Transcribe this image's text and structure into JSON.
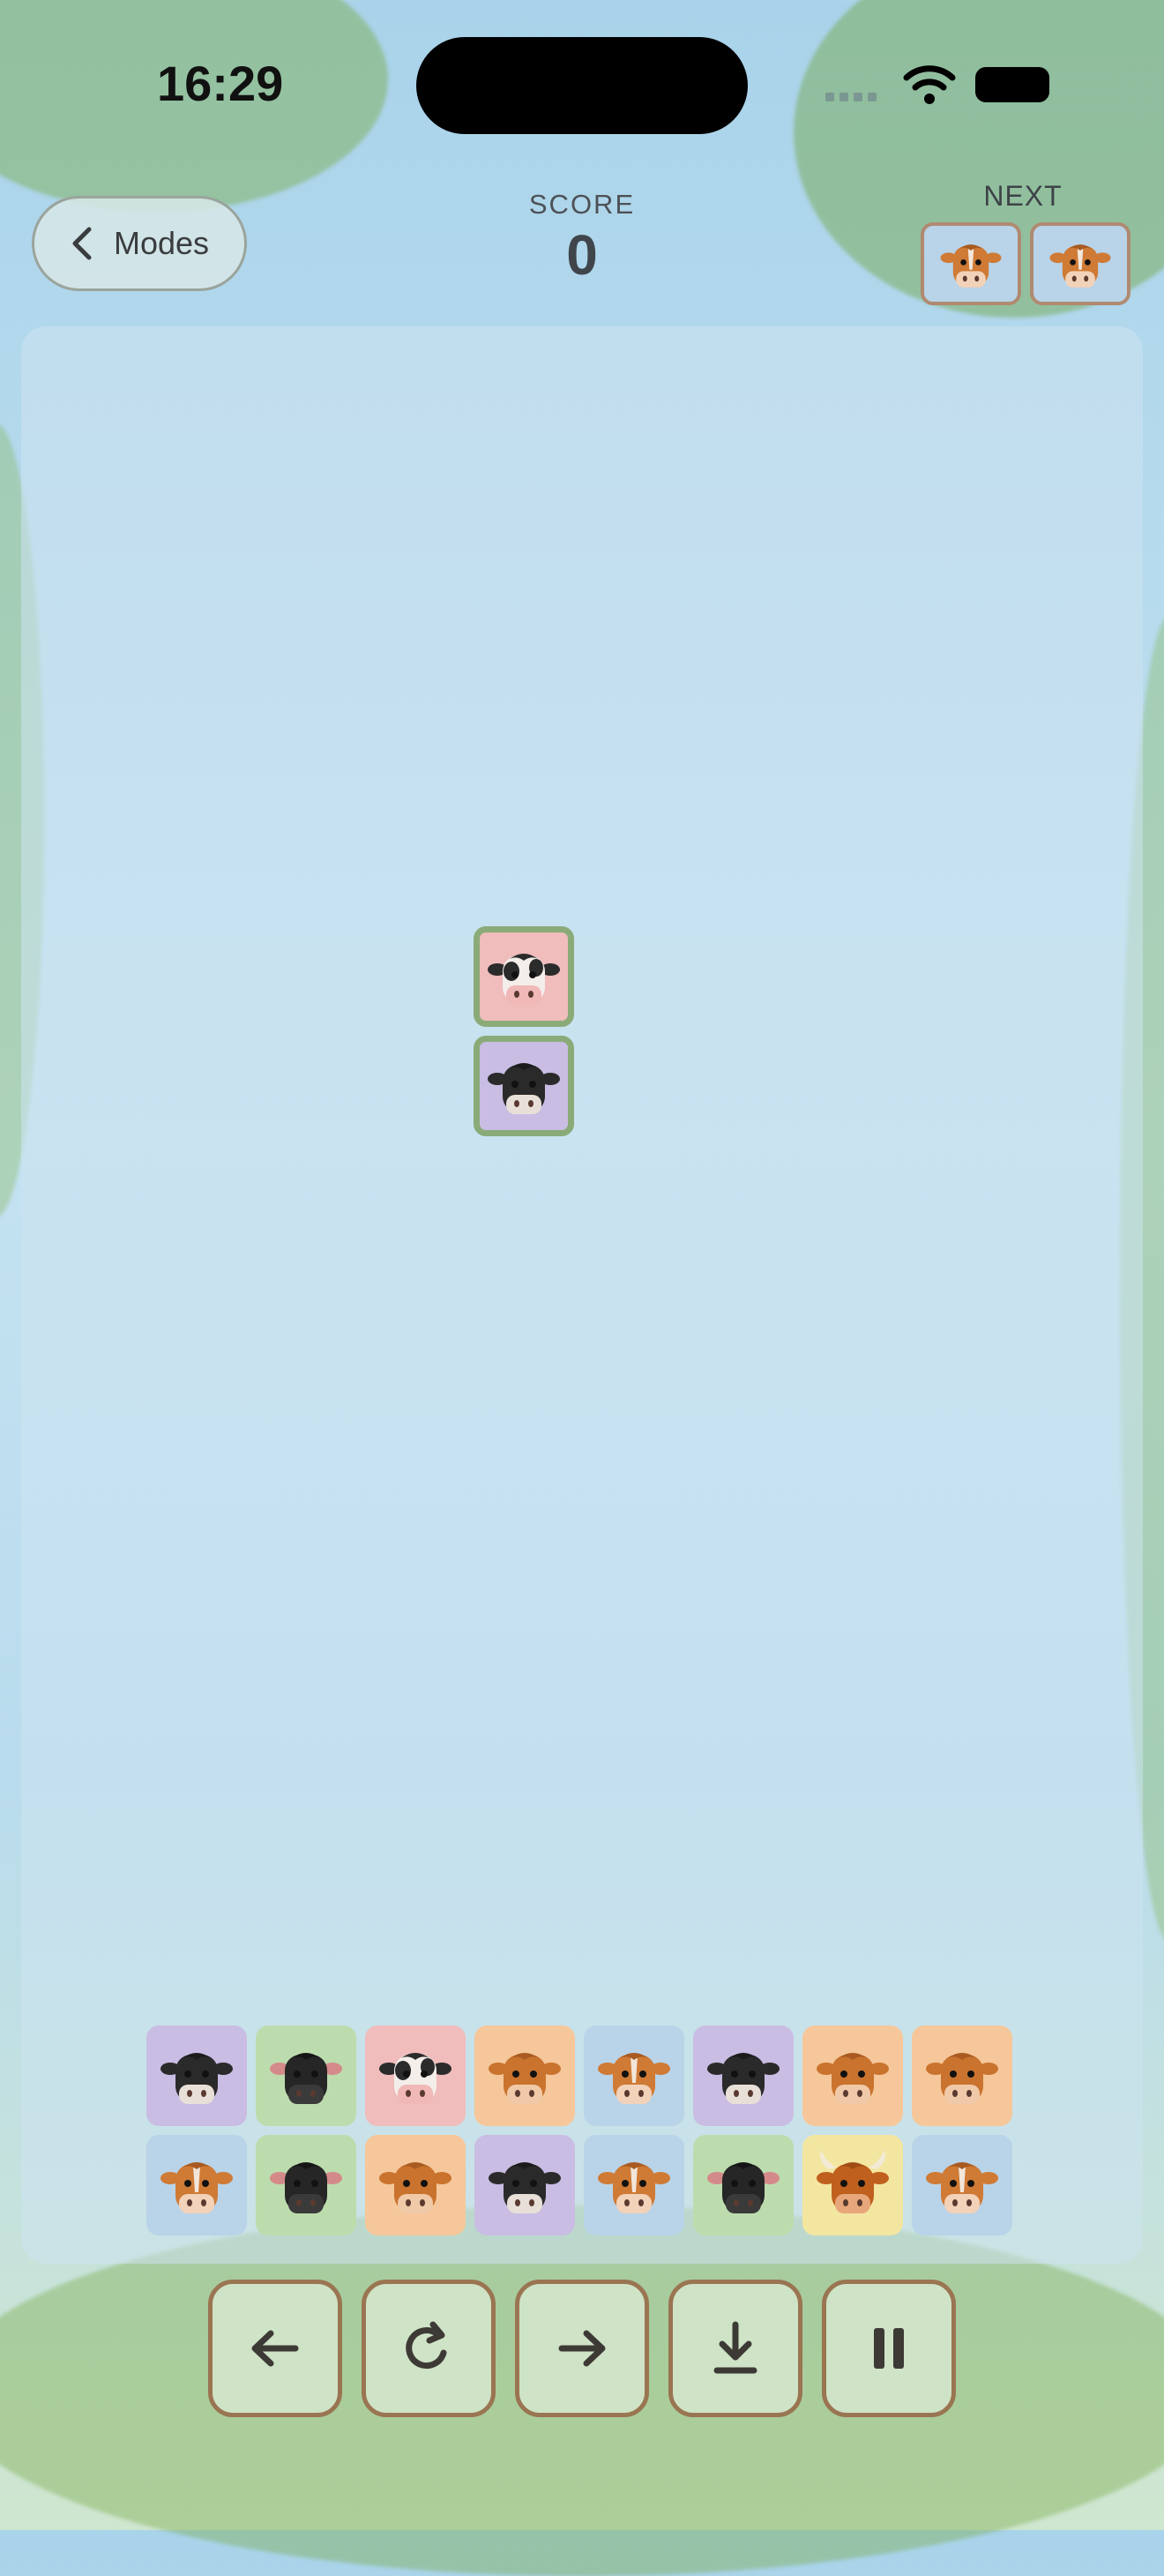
{
  "status_bar": {
    "time": "16:29"
  },
  "header": {
    "modes_label": "Modes",
    "score_label": "SCORE",
    "score_value": "0",
    "next_label": "NEXT"
  },
  "next_pieces": [
    "orange-white-cow-icon",
    "orange-white-cow-icon"
  ],
  "falling_piece": [
    "pink-holstein-cow-icon",
    "black-belted-cow-icon"
  ],
  "board_rows": [
    [
      "black-belted-cow-icon",
      "black-angus-cow-icon",
      "pink-holstein-cow-icon",
      "orange-cow-icon",
      "orange-white-cow-icon",
      "black-belted-cow-icon",
      "orange-cow-icon",
      "orange-cow-icon"
    ],
    [
      "orange-white-cow-icon",
      "black-angus-cow-icon",
      "orange-cow-icon",
      "black-belted-cow-icon",
      "orange-white-cow-icon",
      "black-angus-cow-icon",
      "highland-cow-icon",
      "orange-white-cow-icon"
    ]
  ],
  "controls": [
    "move-left-icon",
    "rotate-icon",
    "move-right-icon",
    "drop-icon",
    "pause-icon"
  ],
  "colors": {
    "tile_purple": "#c9bde3",
    "tile_green": "#bddcae",
    "tile_pink": "#f0bcbc",
    "tile_peach": "#f5c79a",
    "tile_blue": "#b9d3e8",
    "tile_yellow": "#f3e6a0",
    "falling_border": "#8aab78",
    "button_fill": "#cfe3c6",
    "button_border": "#9a7552"
  }
}
